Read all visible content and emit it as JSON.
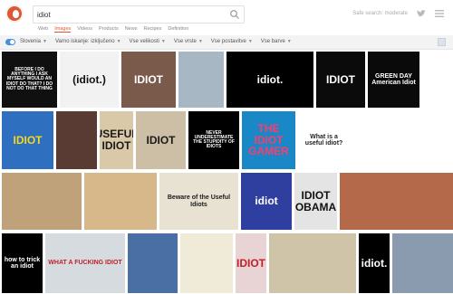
{
  "search": {
    "query": "idiot"
  },
  "header": {
    "region_filter_label": "Safe search: moderate"
  },
  "tabs": [
    "Web",
    "Images",
    "Videos",
    "Products",
    "News",
    "Recipes",
    "Definition"
  ],
  "filterbar": {
    "region": "Slovenia",
    "filters": [
      "Varno iskanje: izključeno",
      "Vse velikosti",
      "Vse vrste",
      "Vse postavitve",
      "Vse barve"
    ]
  },
  "images": [
    {
      "caption": "BEFORE I DO ANYTHING I ASK MYSELF WOULD AN IDIOT DO THAT? I DO NOT DO THAT THING",
      "bg": "#101010",
      "fg": "#ffffff"
    },
    {
      "caption": "(idiot.)",
      "bg": "#f2f2f2",
      "fg": "#111111"
    },
    {
      "caption": "IDIOT",
      "bg": "#7a5a4a",
      "fg": "#ffffff"
    },
    {
      "caption": "",
      "bg": "#a8b7c4",
      "fg": "#ffffff"
    },
    {
      "caption": "idiot.",
      "bg": "#000000",
      "fg": "#ffffff"
    },
    {
      "caption": "IDIOT",
      "bg": "#0b0b0b",
      "fg": "#ffffff"
    },
    {
      "caption": "GREEN DAY American Idiot",
      "bg": "#0a0a0a",
      "fg": "#ffffff"
    },
    {
      "caption": "IDIOT",
      "bg": "#2f6fbf",
      "fg": "#f7d81e"
    },
    {
      "caption": "",
      "bg": "#5a3b33",
      "fg": "#ffffff"
    },
    {
      "caption": "USEFUL IDIOT",
      "bg": "#d9c9a8",
      "fg": "#1a1a1a"
    },
    {
      "caption": "IDIOT",
      "bg": "#cdbfa5",
      "fg": "#1a1a1a"
    },
    {
      "caption": "NEVER UNDERESTIMATE THE STUPIDITY OF IDIOTS",
      "bg": "#000000",
      "fg": "#ffffff"
    },
    {
      "caption": "THE IDIOT GAMER",
      "bg": "#1a88c7",
      "fg": "#ff3b6b"
    },
    {
      "caption": "What is a useful idiot?",
      "bg": "#ffffff",
      "fg": "#222222"
    },
    {
      "caption": "",
      "bg": "#ffffff",
      "fg": "#111111"
    },
    {
      "caption": "",
      "bg": "#bfa27a",
      "fg": "#ffffff"
    },
    {
      "caption": "",
      "bg": "#d7b88a",
      "fg": "#ffffff"
    },
    {
      "caption": "Beware of the Useful Idiots",
      "bg": "#e8e2d2",
      "fg": "#1a1a1a"
    },
    {
      "caption": "idiot",
      "bg": "#2f3fa0",
      "fg": "#ffffff"
    },
    {
      "caption": "IDIOT OBAMA",
      "bg": "#e4e4e4",
      "fg": "#111111"
    },
    {
      "caption": "",
      "bg": "#b46a4a",
      "fg": "#ffffff"
    },
    {
      "caption": "how to trick an idiot",
      "bg": "#000000",
      "fg": "#ffffff"
    },
    {
      "caption": "WHAT A FUCKING IDIOT",
      "bg": "#d6dbe0",
      "fg": "#c0202a"
    },
    {
      "caption": "",
      "bg": "#4a6fa5",
      "fg": "#ffffff"
    },
    {
      "caption": "",
      "bg": "#f0ead8",
      "fg": "#1a1a1a"
    },
    {
      "caption": "IDIOT",
      "bg": "#e8d4d4",
      "fg": "#c0202a"
    },
    {
      "caption": "",
      "bg": "#cfc4a8",
      "fg": "#1a1a1a"
    },
    {
      "caption": "idiot.",
      "bg": "#000000",
      "fg": "#ffffff"
    },
    {
      "caption": "",
      "bg": "#8a9bb0",
      "fg": "#ffffff"
    },
    {
      "caption": "",
      "bg": "#c98a6a",
      "fg": "#ffffff"
    }
  ]
}
